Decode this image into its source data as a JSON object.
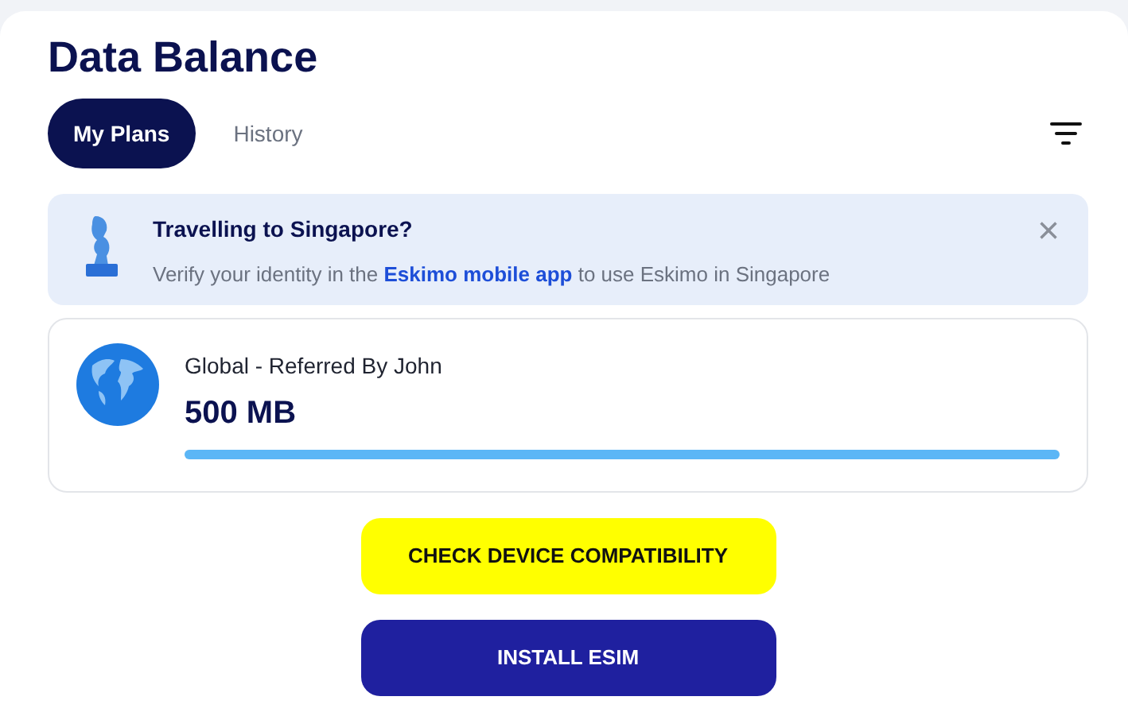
{
  "title": "Data Balance",
  "tabs": [
    {
      "label": "My Plans",
      "selected": true
    },
    {
      "label": "History",
      "selected": false
    }
  ],
  "notice": {
    "heading": "Travelling to Singapore?",
    "text_before": "Verify your identity in the ",
    "link": "Eskimo mobile app",
    "text_after": " to use Eskimo in Singapore",
    "close": "×"
  },
  "plan": {
    "name": "Global - Referred By John",
    "amount": "500 MB",
    "level": 1
  },
  "buttons": [
    {
      "label": "CHECK DEVICE COMPATIBILITY",
      "kind": "secondary"
    },
    {
      "label": "INSTALL ESIM",
      "kind": "primary"
    }
  ]
}
